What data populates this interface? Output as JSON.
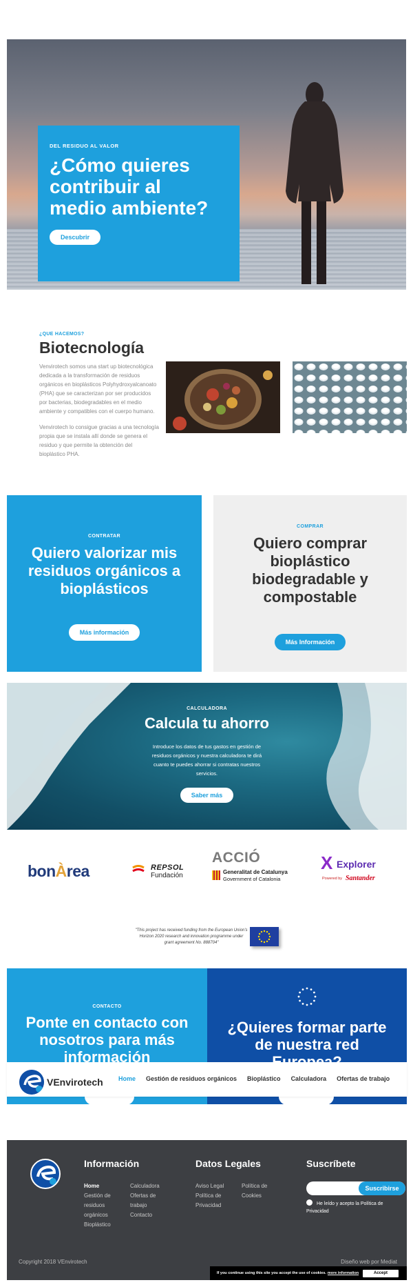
{
  "hero": {
    "eyebrow": "DEL RESIDUO AL VALOR",
    "title": "¿Cómo quieres contribuir al medio ambiente?",
    "button": "Descubrir"
  },
  "biotech": {
    "eyebrow": "¿QUE HACEMOS?",
    "title": "Biotecnología",
    "paragraph_1": "Venvirotech somos una start up biotecnológica dedicada a la transformación de residuos orgánicos en bioplásticos Polyhydroxyalcanoato (PHA) que se caracterizan por ser producidos por bacterias, biodegradables en el medio ambiente y compatibles con el cuerpo humano.",
    "paragraph_2": "Venvirotech lo consigue gracias a una tecnología propia que se instala allí donde se genera el residuo y que permite la obtención del bioplástico PHA."
  },
  "cta": {
    "left": {
      "eyebrow": "CONTRATAR",
      "title": "Quiero valorizar mis residuos orgánicos a bioplásticos",
      "button": "Más información"
    },
    "right": {
      "eyebrow": "COMPRAR",
      "title": "Quiero comprar bioplástico biodegradable y compostable",
      "button": "Más Información"
    }
  },
  "calculator": {
    "eyebrow": "CALCULADORA",
    "title": "Calcula tu ahorro",
    "text": "Introduce los datos de tus gastos en gestión de residuos orgánicos y nuestra calculadora te dirá cuanto te puedes ahorrar si contratas nuestros servicios.",
    "button": "Saber más"
  },
  "partners": {
    "bonarea": {
      "prefix": "bon",
      "accent": "À",
      "suffix": "rea"
    },
    "repsol": {
      "name": "REPSOL",
      "sub": "Fundación"
    },
    "accio": {
      "name": "ACCIÓ",
      "line1": "Generalitat de Catalunya",
      "line2": "Government of Catalonia"
    },
    "explorer": {
      "mark": "X",
      "name": "Explorer",
      "powered": "Powered by",
      "sponsor": "Santander"
    }
  },
  "eu_notice": "\"This project has received funding from the European Union's Horizon 2020 research and innovation programme under grant agreement No. 888704\"",
  "contact": {
    "left": {
      "eyebrow": "CONTACTO",
      "title": "Ponte en contacto con nosotros para más información"
    },
    "right": {
      "title": "¿Quieres formar parte de nuestra red Europea?"
    }
  },
  "nav": {
    "brand": "VEnvirotech",
    "links": [
      "Home",
      "Gestión de residuos orgánicos",
      "Bioplástico",
      "Calculadora",
      "Ofertas de trabajo"
    ]
  },
  "footer": {
    "info_title": "Información",
    "info_col1": [
      "Home",
      "Gestión de",
      "residuos",
      "orgánicos",
      "Bioplástico"
    ],
    "info_col2": [
      "Calculadora",
      "Ofertas de",
      "trabajo",
      "Contacto"
    ],
    "legal_title": "Datos Legales",
    "legal_col1": [
      "Aviso Legal",
      "Política de",
      "Privacidad"
    ],
    "legal_col2": [
      "Política de",
      "Cookies"
    ],
    "subscribe_title": "Suscríbete",
    "subscribe_button": "Suscribirse",
    "consent": "He leído y acepto la Política de Privacidad",
    "copyright": "Copyright 2018 VEnvirotech",
    "madeby": "Diseño web por Mediat"
  },
  "cookie": {
    "text": "If you continue using this site you accept the use of cookies.",
    "more": "more information",
    "accept": "Accept"
  },
  "colors": {
    "accent": "#1ea0dd",
    "navy": "#0f4fa6",
    "footer": "#3d3f43"
  }
}
